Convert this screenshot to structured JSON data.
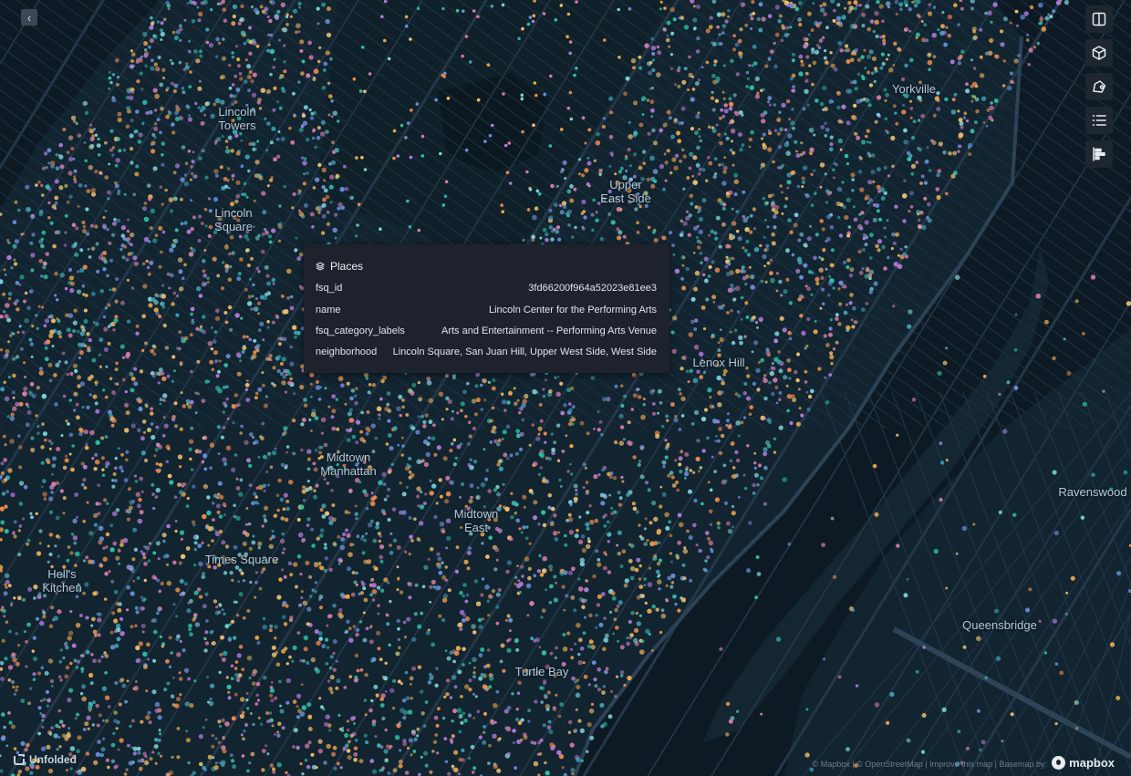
{
  "map": {
    "background_color": "#0d1a24",
    "land_color": "#122430",
    "street_color": "#24384a",
    "water_color": "#0d1a24",
    "park_color": "#0f2028",
    "point_palette": [
      "#2fbfa8",
      "#3d9fb0",
      "#e8a64c",
      "#f0c070",
      "#b07ad8",
      "#d37aa8",
      "#7bd0d8",
      "#e58a4e",
      "#6a8fd8"
    ],
    "labels": [
      {
        "text": "Lincoln\nTowers"
      },
      {
        "text": "Lincoln\nSquare"
      },
      {
        "text": "Upper\nEast Side"
      },
      {
        "text": "Yorkville"
      },
      {
        "text": "Lenox Hill"
      },
      {
        "text": "Midtown\nManhattan"
      },
      {
        "text": "Midtown\nEast"
      },
      {
        "text": "Times Square"
      },
      {
        "text": "Hell's\nKitchen"
      },
      {
        "text": "Ravenswood"
      },
      {
        "text": "Queensbridge"
      },
      {
        "text": "Turtle Bay"
      }
    ]
  },
  "controls": {
    "collapse_icon": "chevron-left-icon",
    "collapse_glyph": "‹",
    "toolbar": [
      {
        "name": "split-map-button",
        "icon": "split-map-icon"
      },
      {
        "name": "3d-view-button",
        "icon": "cube-icon"
      },
      {
        "name": "draw-button",
        "icon": "polygon-draw-icon"
      },
      {
        "name": "layer-legend-button",
        "icon": "list-icon"
      },
      {
        "name": "timeline-button",
        "icon": "bar-chart-icon"
      }
    ]
  },
  "tooltip": {
    "layer_icon": "layers-icon",
    "layer_name": "Places",
    "rows": [
      {
        "key": "fsq_id",
        "value": "3fd66200f964a52023e81ee3"
      },
      {
        "key": "name",
        "value": "Lincoln Center for the Performing Arts"
      },
      {
        "key": "fsq_category_labels",
        "value": "Arts and Entertainment -- Performing Arts Venue"
      },
      {
        "key": "neighborhood",
        "value": "Lincoln Square, San Juan Hill, Upper West Side, West Side"
      }
    ]
  },
  "footer": {
    "brand": "Unfolded",
    "brand_icon": "unfolded-logo-icon",
    "attribution": "© Mapbox | © OpenStreetMap | Improve this map | Basemap by:",
    "mapbox_logo": "mapbox"
  }
}
